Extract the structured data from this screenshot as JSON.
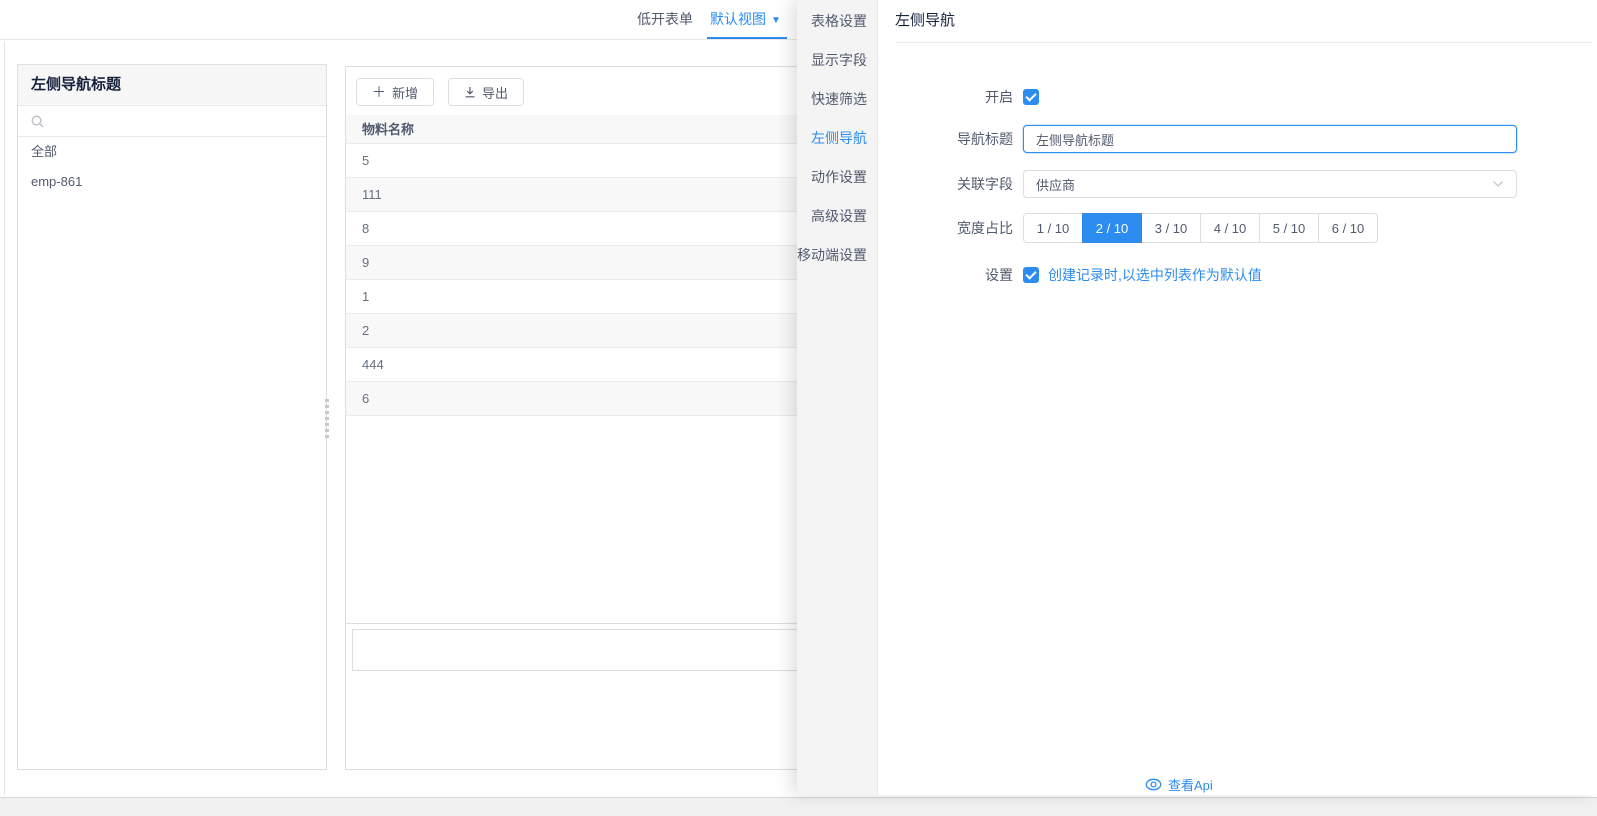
{
  "tab_bar": {
    "tabs": [
      {
        "label": "低开表单",
        "active": false
      },
      {
        "label": "默认视图",
        "active": true
      }
    ]
  },
  "left_panel": {
    "title": "左侧导航标题",
    "search_value": "",
    "items": [
      {
        "label": "全部"
      },
      {
        "label": "emp-861"
      }
    ]
  },
  "toolbar": {
    "add_label": "新增",
    "export_label": "导出"
  },
  "table": {
    "columns": [
      "物料名称"
    ],
    "rows": [
      "5",
      "111",
      "8",
      "9",
      "1",
      "2",
      "444",
      "6"
    ]
  },
  "drawer": {
    "menu_items": [
      "表格设置",
      "显示字段",
      "快速筛选",
      "左侧导航",
      "动作设置",
      "高级设置",
      "移动端设置"
    ],
    "active_item": "左侧导航",
    "panel_title": "左侧导航",
    "form": {
      "enable": {
        "label": "开启",
        "checked": true
      },
      "nav_title": {
        "label": "导航标题",
        "value": "左侧导航标题"
      },
      "related_field": {
        "label": "关联字段",
        "value": "供应商"
      },
      "width_ratio": {
        "label": "宽度占比",
        "options": [
          "1 / 10",
          "2 / 10",
          "3 / 10",
          "4 / 10",
          "5 / 10",
          "6 / 10"
        ],
        "selected": "2 / 10"
      },
      "settings": {
        "label": "设置",
        "checked": true,
        "option_label": "创建记录时,以选中列表作为默认值"
      }
    },
    "footer": {
      "view_api_label": "查看Api"
    }
  },
  "icons": {
    "tab_caret": "▼",
    "add_plus": "＋",
    "export": "download-icon",
    "search": "magnifier-icon",
    "select_chevron": "chevron-down-icon",
    "view_api": "eye-icon"
  },
  "colors": {
    "accent": "#2d8cf0",
    "border": "#dcdee2",
    "stripe": "#f8f8f9",
    "sidebar_bg": "#f4f4f5"
  }
}
